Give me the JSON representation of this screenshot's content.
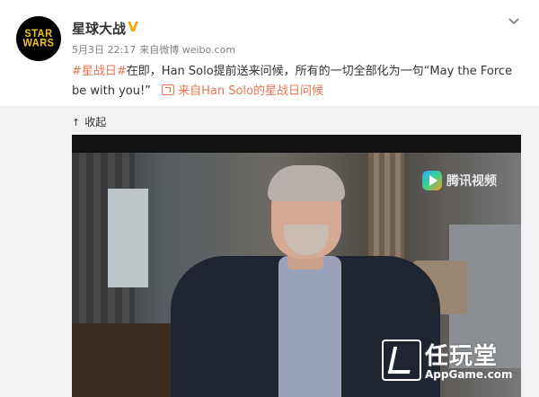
{
  "post": {
    "author_name": "星球大战",
    "avatar_text": "STAR WARS",
    "verified_badge": "V",
    "date": "5月3日 22:17",
    "source": "来自微博 weibo.com",
    "hashtag": "#星战日#",
    "text_main": "在即，Han Solo提前送来问候，所有的一切全部化为一句“May the Force be with you!”",
    "link_text": "来自Han Solo的星战日问候"
  },
  "media": {
    "collapse_label": "收起",
    "video_logo_text": "腾讯视频"
  },
  "watermark": {
    "cn": "任玩堂",
    "en": "AppGame.com"
  },
  "colors": {
    "link": "#eb7350",
    "panel_bg": "#f2f2f5"
  }
}
